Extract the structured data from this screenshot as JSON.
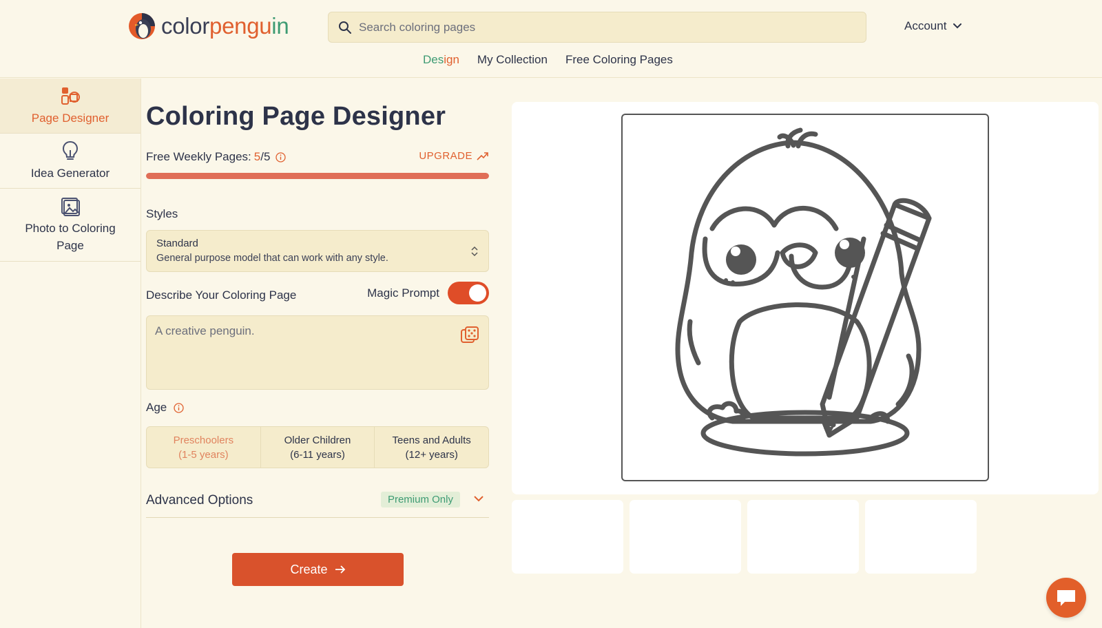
{
  "brand": {
    "name_part1": "color",
    "name_part2": "pengu",
    "name_part3": "in",
    "accent": "#e0602f",
    "green": "#3e9b73"
  },
  "search": {
    "placeholder": "Search coloring pages"
  },
  "account": {
    "label": "Account"
  },
  "nav": {
    "design_part1": "Des",
    "design_part2": "ign",
    "my_collection": "My Collection",
    "free_pages": "Free Coloring Pages"
  },
  "sidebar": {
    "items": [
      {
        "label": "Page Designer",
        "icon": "palette-icon",
        "active": true
      },
      {
        "label": "Idea Generator",
        "icon": "lightbulb-icon",
        "active": false
      },
      {
        "label": "Photo to Coloring Page",
        "icon": "image-icon",
        "active": false
      }
    ]
  },
  "designer": {
    "title": "Coloring Page Designer",
    "quota_label": "Free Weekly Pages:",
    "quota_used": "5",
    "quota_total": "/5",
    "quota_fraction": 1.0,
    "upgrade": "UPGRADE",
    "styles_label": "Styles",
    "style_name": "Standard",
    "style_desc": "General purpose model that can work with any style.",
    "describe_label": "Describe Your Coloring Page",
    "magic_prompt_label": "Magic Prompt",
    "magic_prompt_on": true,
    "prompt_placeholder": "A creative penguin.",
    "age_label": "Age",
    "age_options": [
      {
        "line1": "Preschoolers",
        "line2": "(1-5 years)",
        "selected": true
      },
      {
        "line1": "Older Children",
        "line2": "(6-11 years)",
        "selected": false
      },
      {
        "line1": "Teens and Adults",
        "line2": "(12+ years)",
        "selected": false
      }
    ],
    "advanced_label": "Advanced Options",
    "premium_badge": "Premium Only",
    "create_label": "Create"
  },
  "preview": {
    "image_subject": "penguin holding a pencil",
    "thumbnail_count": 4
  }
}
